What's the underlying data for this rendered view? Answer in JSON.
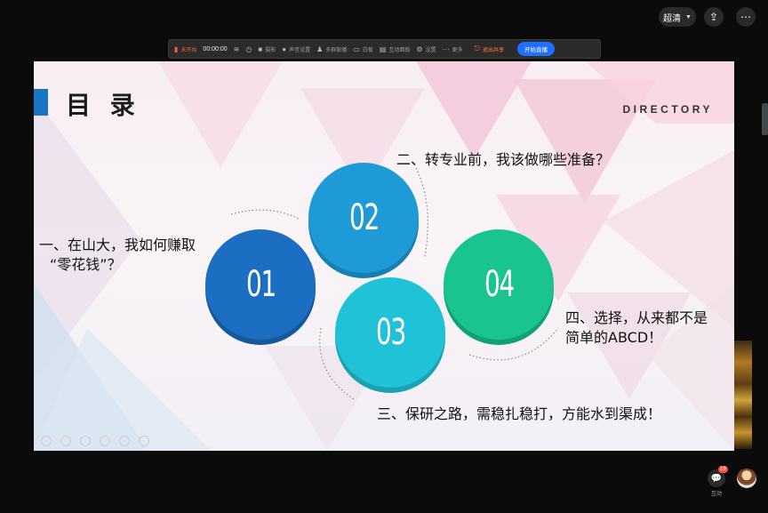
{
  "header": {
    "quality_label": "超清",
    "share_icon": "share-icon",
    "more_icon": "more-icon"
  },
  "toolbar": {
    "status": "未开始",
    "timer": "00:00:00",
    "items": [
      {
        "icon": "wifi-icon",
        "label": ""
      },
      {
        "icon": "clock-icon",
        "label": ""
      },
      {
        "icon": "camera-icon",
        "label": "摄影"
      },
      {
        "icon": "mic-icon",
        "label": "声音设置"
      },
      {
        "icon": "person-icon",
        "label": "多群联播"
      },
      {
        "icon": "whiteboard-icon",
        "label": "白板"
      },
      {
        "icon": "chat-icon",
        "label": "互动面板"
      },
      {
        "icon": "gear-icon",
        "label": "设置"
      },
      {
        "icon": "more-icon",
        "label": "更多"
      }
    ],
    "exit_label": "退出共享",
    "live_label": "开始直播"
  },
  "slide": {
    "title": "目 录",
    "subtitle": "DIRECTORY",
    "items": [
      {
        "number": "01",
        "color": "#1b6ec2",
        "line1": "一、在山大，我如何赚取",
        "line2": "“零花钱”？"
      },
      {
        "number": "02",
        "color": "#1e9ad6",
        "line1": "二、转专业前，我该做哪些准备？",
        "line2": ""
      },
      {
        "number": "03",
        "color": "#20c2d8",
        "line1": "三、保研之路，需稳扎稳打，方能水到渠成！",
        "line2": ""
      },
      {
        "number": "04",
        "color": "#19c48f",
        "line1": "四、选择，从来都不是",
        "line2": "简单的ABCD！"
      }
    ]
  },
  "footer": {
    "interact_label": "互动",
    "badge_count": "19"
  }
}
